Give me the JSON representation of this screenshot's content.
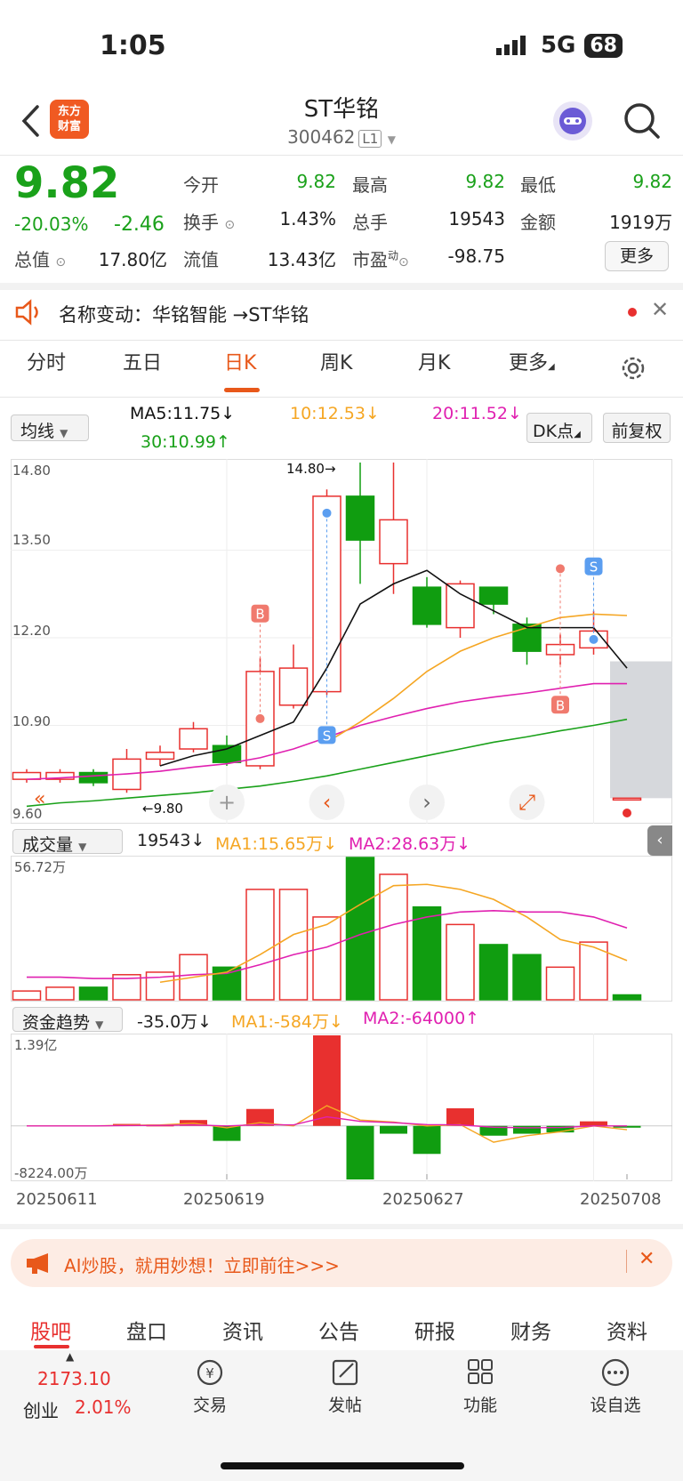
{
  "status": {
    "time": "1:05",
    "network": "5G",
    "battery": "68"
  },
  "header": {
    "title": "ST华铭",
    "code": "300462",
    "level": "L1",
    "logo_line1": "东方",
    "logo_line2": "财富"
  },
  "quote": {
    "price": "9.82",
    "change_pct": "-20.03%",
    "change": "-2.46",
    "fields": {
      "open_label": "今开",
      "open": "9.82",
      "high_label": "最高",
      "high": "9.82",
      "low_label": "最低",
      "low": "9.82",
      "turnover_label": "换手",
      "turnover": "1.43%",
      "volume_label": "总手",
      "volume": "19543",
      "amount_label": "金额",
      "amount": "1919万",
      "mktcap_label": "总值",
      "mktcap": "17.80亿",
      "float_label": "流值",
      "float": "13.43亿",
      "pe_label": "市盈",
      "pe_sup": "动",
      "pe": "-98.75"
    },
    "more_label": "更多"
  },
  "notice": {
    "text": "名称变动：华铭智能 →ST华铭"
  },
  "period_tabs": [
    "分时",
    "五日",
    "日K",
    "周K",
    "月K",
    "更多"
  ],
  "ma_bar": {
    "selector": "均线",
    "ma5": "MA5:11.75↓",
    "ma10": "10:12.53↓",
    "ma20": "20:11.52↓",
    "ma30": "30:10.99↑",
    "dk_label": "DK点",
    "adjust_label": "前复权"
  },
  "volume_bar": {
    "selector": "成交量",
    "value": "19543↓",
    "ma1": "MA1:15.65万↓",
    "ma2": "MA2:28.63万↓"
  },
  "fund_bar": {
    "selector": "资金趋势",
    "value": "-35.0万↓",
    "ma1": "MA1:-584万↓",
    "ma2": "MA2:-64000↑"
  },
  "colors": {
    "up": "#e8302f",
    "down": "#109d10",
    "ma5": "#111111",
    "ma10": "#f5a623",
    "ma20": "#e020b0",
    "ma30": "#1aa11a",
    "accent": "#e8581a"
  },
  "chart_data": [
    {
      "type": "candlestick",
      "title": "",
      "ylim": [
        9.6,
        14.8
      ],
      "y_ticks": [
        "14.80",
        "13.50",
        "12.20",
        "10.90",
        "9.60"
      ],
      "max_label": "14.80→",
      "min_label": "←9.80",
      "markers": [
        {
          "label": "B",
          "index": 7
        },
        {
          "label": "S",
          "index": 9
        },
        {
          "label": "S",
          "index": 17
        },
        {
          "label": "B",
          "index": 16
        }
      ],
      "candles": [
        {
          "o": 10.1,
          "c": 10.2,
          "h": 10.25,
          "l": 10.05
        },
        {
          "o": 10.1,
          "c": 10.2,
          "h": 10.25,
          "l": 10.05
        },
        {
          "o": 10.2,
          "c": 10.05,
          "h": 10.25,
          "l": 10.0
        },
        {
          "o": 9.95,
          "c": 10.4,
          "h": 10.55,
          "l": 9.9
        },
        {
          "o": 10.4,
          "c": 10.5,
          "h": 10.6,
          "l": 10.3
        },
        {
          "o": 10.55,
          "c": 10.85,
          "h": 10.95,
          "l": 10.5
        },
        {
          "o": 10.6,
          "c": 10.35,
          "h": 10.75,
          "l": 10.3
        },
        {
          "o": 10.3,
          "c": 11.7,
          "h": 11.9,
          "l": 10.25
        },
        {
          "o": 11.2,
          "c": 11.75,
          "h": 12.1,
          "l": 11.15
        },
        {
          "o": 11.4,
          "c": 14.3,
          "h": 14.4,
          "l": 11.35
        },
        {
          "o": 14.3,
          "c": 13.65,
          "h": 14.8,
          "l": 13.0
        },
        {
          "o": 13.3,
          "c": 13.95,
          "h": 14.8,
          "l": 12.85
        },
        {
          "o": 12.95,
          "c": 12.4,
          "h": 13.1,
          "l": 12.35
        },
        {
          "o": 12.35,
          "c": 13.0,
          "h": 13.05,
          "l": 12.2
        },
        {
          "o": 12.95,
          "c": 12.7,
          "h": 12.95,
          "l": 12.55
        },
        {
          "o": 12.4,
          "c": 12.0,
          "h": 12.5,
          "l": 11.8
        },
        {
          "o": 11.95,
          "c": 12.1,
          "h": 12.25,
          "l": 11.8
        },
        {
          "o": 12.05,
          "c": 12.3,
          "h": 12.6,
          "l": 11.95
        },
        {
          "o": 9.82,
          "c": 9.82,
          "h": 9.82,
          "l": 9.82
        }
      ],
      "ma5": [
        null,
        null,
        null,
        null,
        10.3,
        10.45,
        10.55,
        10.75,
        10.95,
        11.75,
        12.7,
        13.0,
        13.2,
        12.85,
        12.6,
        12.35,
        12.35,
        12.35,
        11.75
      ],
      "ma10": [
        null,
        null,
        null,
        null,
        null,
        null,
        null,
        null,
        null,
        10.65,
        10.95,
        11.3,
        11.7,
        12.0,
        12.2,
        12.35,
        12.5,
        12.55,
        12.53
      ],
      "ma20": [
        10.1,
        10.12,
        10.15,
        10.18,
        10.22,
        10.28,
        10.33,
        10.42,
        10.55,
        10.72,
        10.9,
        11.03,
        11.15,
        11.25,
        11.32,
        11.38,
        11.45,
        11.52,
        11.52
      ],
      "ma30": [
        9.7,
        9.75,
        9.78,
        9.82,
        9.86,
        9.9,
        9.95,
        10.0,
        10.07,
        10.15,
        10.25,
        10.35,
        10.45,
        10.55,
        10.65,
        10.73,
        10.82,
        10.9,
        10.99
      ]
    },
    {
      "type": "bar",
      "title": "成交量",
      "ymax_label": "56.72万",
      "ylim": [
        0,
        56.72
      ],
      "values": [
        3.5,
        5.0,
        5.0,
        10.0,
        11.0,
        18.0,
        13.0,
        44.0,
        44.0,
        33.0,
        56.72,
        50.0,
        37.0,
        30.0,
        22.0,
        18.0,
        13.0,
        23.0,
        1.95
      ],
      "up": [
        true,
        true,
        false,
        true,
        true,
        true,
        false,
        true,
        true,
        true,
        false,
        true,
        false,
        true,
        false,
        false,
        true,
        true,
        false
      ],
      "ma1": [
        null,
        null,
        null,
        null,
        7.0,
        9.0,
        11.0,
        18.0,
        26.0,
        30.0,
        38.0,
        45.5,
        46.0,
        44.0,
        40.0,
        33.0,
        24.0,
        21.0,
        15.65
      ],
      "ma2": [
        9.0,
        9.0,
        8.5,
        8.5,
        9.0,
        10.0,
        10.5,
        14.0,
        18.0,
        21.0,
        26.0,
        30.0,
        33.0,
        35.0,
        35.5,
        35.0,
        35.0,
        33.0,
        28.63
      ]
    },
    {
      "type": "bar",
      "title": "资金趋势",
      "ymax_label": "1.39亿",
      "ymin_label": "-8224.00万",
      "ylim": [
        -8224,
        13900
      ],
      "values": [
        0,
        0,
        0,
        300,
        200,
        900,
        -2300,
        2600,
        0,
        13900,
        -8224,
        -1200,
        -4300,
        2700,
        -1500,
        -1200,
        -1000,
        700,
        -35
      ],
      "ma1": [
        0,
        0,
        0,
        100,
        150,
        400,
        -300,
        500,
        0,
        3100,
        900,
        600,
        0,
        200,
        -2500,
        -1500,
        -900,
        0,
        -584
      ],
      "ma2": [
        0,
        0,
        0,
        50,
        80,
        150,
        0,
        200,
        150,
        1400,
        700,
        500,
        200,
        150,
        -200,
        -300,
        -250,
        0,
        -6.4
      ]
    }
  ],
  "x_dates": [
    "20250611",
    "20250619",
    "20250627",
    "20250708"
  ],
  "ai_banner": "AI炒股，就用妙想！立即前往>>>",
  "bottom_tabs": [
    "股吧",
    "盘口",
    "资讯",
    "公告",
    "研报",
    "财务",
    "资料"
  ],
  "bottom_bar": {
    "index_value": "2173.10",
    "index_name": "创业",
    "index_pct": "2.01%",
    "items": [
      {
        "label": "交易",
        "icon": "trade-icon"
      },
      {
        "label": "发帖",
        "icon": "post-icon"
      },
      {
        "label": "功能",
        "icon": "apps-icon"
      },
      {
        "label": "设自选",
        "icon": "more-icon"
      }
    ]
  }
}
